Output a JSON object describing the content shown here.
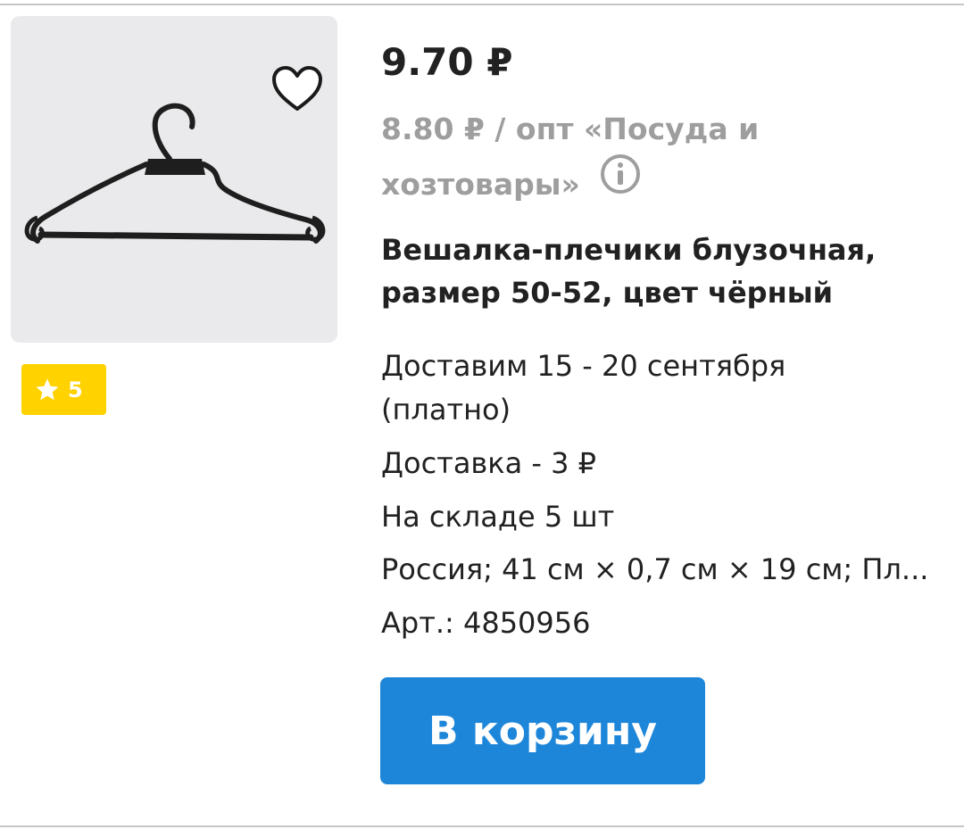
{
  "product": {
    "image": {
      "alt": "black plastic clothes hanger",
      "background": "#eaeaec"
    },
    "favorite_icon": "heart-outline-icon",
    "rating": {
      "icon": "star-icon",
      "value": "5",
      "badge_color": "#ffd200"
    },
    "price": "9.70 ₽",
    "wholesale_text": "8.80 ₽ / опт «Посуда и хозтовары»",
    "wholesale_info_icon": "info-circle-icon",
    "title": "Вешалка-плечики блузочная, размер 50-52, цвет чёрный",
    "delivery_when": "Доставим 15 - 20 сентября (платно)",
    "delivery_cost": "Доставка - 3 ₽",
    "stock": "На складе 5 шт",
    "specs": "Россия; 41 см × 0,7 см × 19 см; Пл...",
    "article": "Арт.: 4850956",
    "cart_button": {
      "label": "В корзину",
      "color": "#1e86d9"
    }
  }
}
